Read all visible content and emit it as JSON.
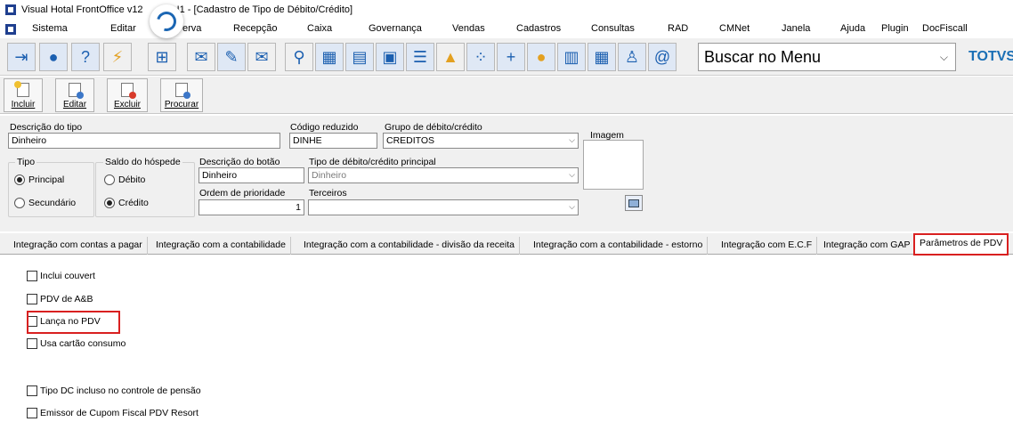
{
  "window": {
    "title_left": "Visual Hotal FrontOffice v12",
    "title_right": "I1 - [Cadastro de Tipo de Débito/Crédito]"
  },
  "menu": [
    {
      "label": "Sistema"
    },
    {
      "label": "Editar"
    },
    {
      "label": "erva"
    },
    {
      "label": "Recepção"
    },
    {
      "label": "Caixa"
    },
    {
      "label": "Governança"
    },
    {
      "label": "Vendas"
    },
    {
      "label": "Cadastros"
    },
    {
      "label": "Consultas"
    },
    {
      "label": "RAD"
    },
    {
      "label": "CMNet"
    },
    {
      "label": "Janela"
    },
    {
      "label": "Ajuda"
    },
    {
      "label": "Plugin"
    },
    {
      "label": "DocFiscall"
    }
  ],
  "toolbar": {
    "search_value": "Buscar no Menu",
    "brand": "TOTVS HO"
  },
  "actions": {
    "incluir": "Incluir",
    "editar": "Editar",
    "excluir": "Excluir",
    "procurar": "Procurar"
  },
  "form": {
    "descricao_label": "Descrição do tipo",
    "descricao_value": "Dinheiro",
    "codigo_label": "Código reduzido",
    "codigo_value": "DINHE",
    "grupo_label": "Grupo de débito/crédito",
    "grupo_value": "CREDITOS",
    "imagem_label": "Imagem",
    "tipo_label": "Tipo",
    "tipo_principal": "Principal",
    "tipo_secundario": "Secundário",
    "saldo_label": "Saldo do hóspede",
    "saldo_debito": "Débito",
    "saldo_credito": "Crédito",
    "botao_label": "Descrição do botão",
    "botao_value": "Dinheiro",
    "tipo_principal_label": "Tipo de débito/crédito principal",
    "tipo_principal_value": "Dinheiro",
    "prioridade_label": "Ordem de prioridade",
    "prioridade_value": "1",
    "terceiros_label": "Terceiros",
    "terceiros_value": ""
  },
  "tabs": [
    {
      "label": "Integração com contas a pagar"
    },
    {
      "label": "Integração com a contabilidade"
    },
    {
      "label": "Integração com a contabilidade - divisão da receita"
    },
    {
      "label": "Integração com a contabilidade - estorno"
    },
    {
      "label": "Integração com E.C.F"
    },
    {
      "label": "Integração com GAP"
    },
    {
      "label": "Parâmetros de PDV"
    }
  ],
  "checkboxes": [
    {
      "label": "Inclui couvert"
    },
    {
      "label": "PDV de A&B"
    },
    {
      "label": "Lança no PDV"
    },
    {
      "label": "Usa cartão consumo"
    },
    {
      "label": "Tipo DC incluso no controle de pensão"
    },
    {
      "label": "Emissor de Cupom Fiscal PDV Resort"
    }
  ],
  "colors": {
    "highlight": "#d92020",
    "brand": "#1a6fb5"
  }
}
